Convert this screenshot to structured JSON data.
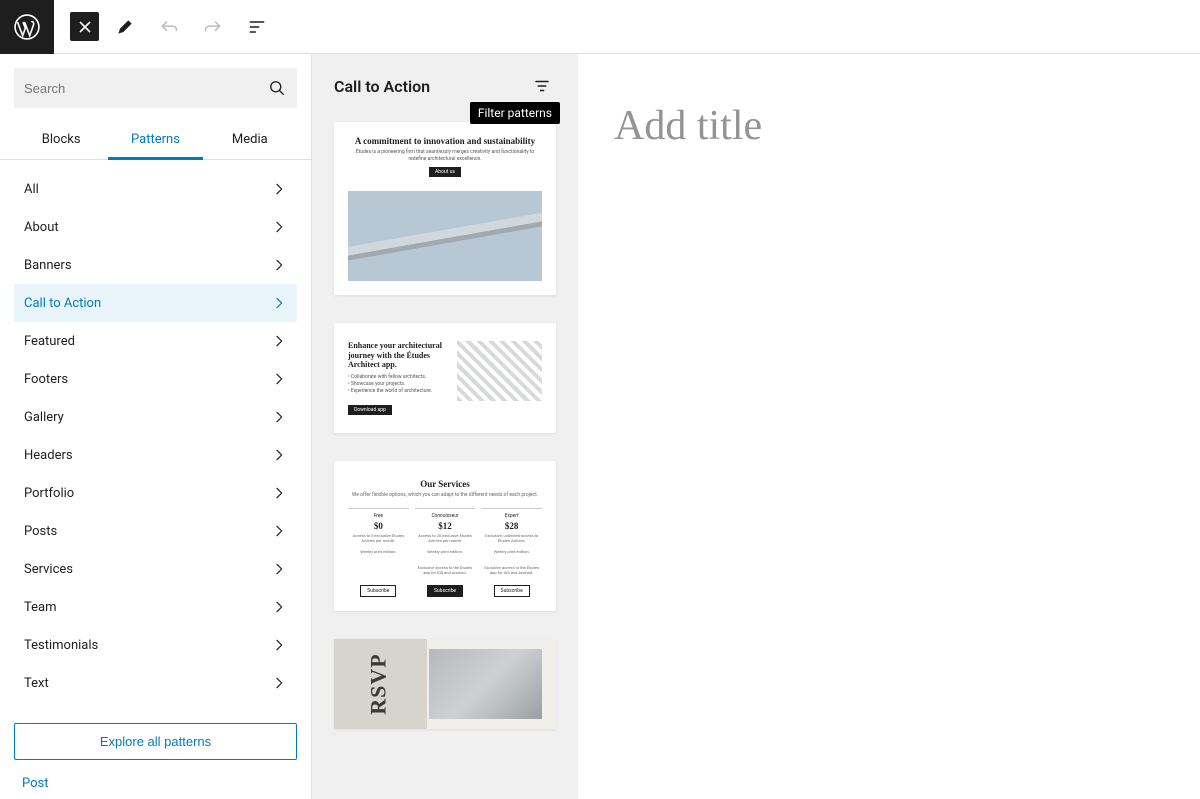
{
  "toolbar": {
    "close_label": "Close inserter"
  },
  "search": {
    "placeholder": "Search"
  },
  "tabs": {
    "blocks": "Blocks",
    "patterns": "Patterns",
    "media": "Media"
  },
  "categories": [
    "All",
    "About",
    "Banners",
    "Call to Action",
    "Featured",
    "Footers",
    "Gallery",
    "Headers",
    "Portfolio",
    "Posts",
    "Services",
    "Team",
    "Testimonials",
    "Text"
  ],
  "selected_category_index": 3,
  "explore_label": "Explore all patterns",
  "footer_link": "Post",
  "patterns_panel": {
    "heading": "Call to Action",
    "filter_tooltip": "Filter patterns"
  },
  "pattern_previews": {
    "p1": {
      "title": "A commitment to innovation and sustainability",
      "sub": "Études is a pioneering firm that seamlessly merges creativity and functionality to redefine architectural excellence.",
      "btn": "About us"
    },
    "p2": {
      "title": "Enhance your architectural journey with the Études Architect app.",
      "l1": "• Collaborate with fellow architects.",
      "l2": "• Showcase your projects.",
      "l3": "• Experience the world of architecture.",
      "btn": "Download app"
    },
    "p3": {
      "title": "Our Services",
      "sub": "We offer flexible options, which you can adapt to the different needs of each project.",
      "tiers": [
        {
          "name": "Free",
          "price": "$0",
          "d1": "Access to 5 exclusive Études Articles per month.",
          "d2": "Weekly print edition.",
          "btn": "Subscribe"
        },
        {
          "name": "Connoisseur",
          "price": "$12",
          "d1": "Access to 20 exclusive Études Articles per month.",
          "d2": "Weekly print edition.",
          "d3": "Exclusive access to the Études app for iOS and Android.",
          "btn": "Subscribe"
        },
        {
          "name": "Expert",
          "price": "$28",
          "d1": "Exclusive, unlimited access to Études Articles.",
          "d2": "Weekly print edition.",
          "d3": "Exclusive access to the Études app for iOS and Android.",
          "btn": "Subscribe"
        }
      ]
    },
    "p4": {
      "rsvp": "RSVP"
    }
  },
  "canvas": {
    "title_placeholder": "Add title"
  }
}
